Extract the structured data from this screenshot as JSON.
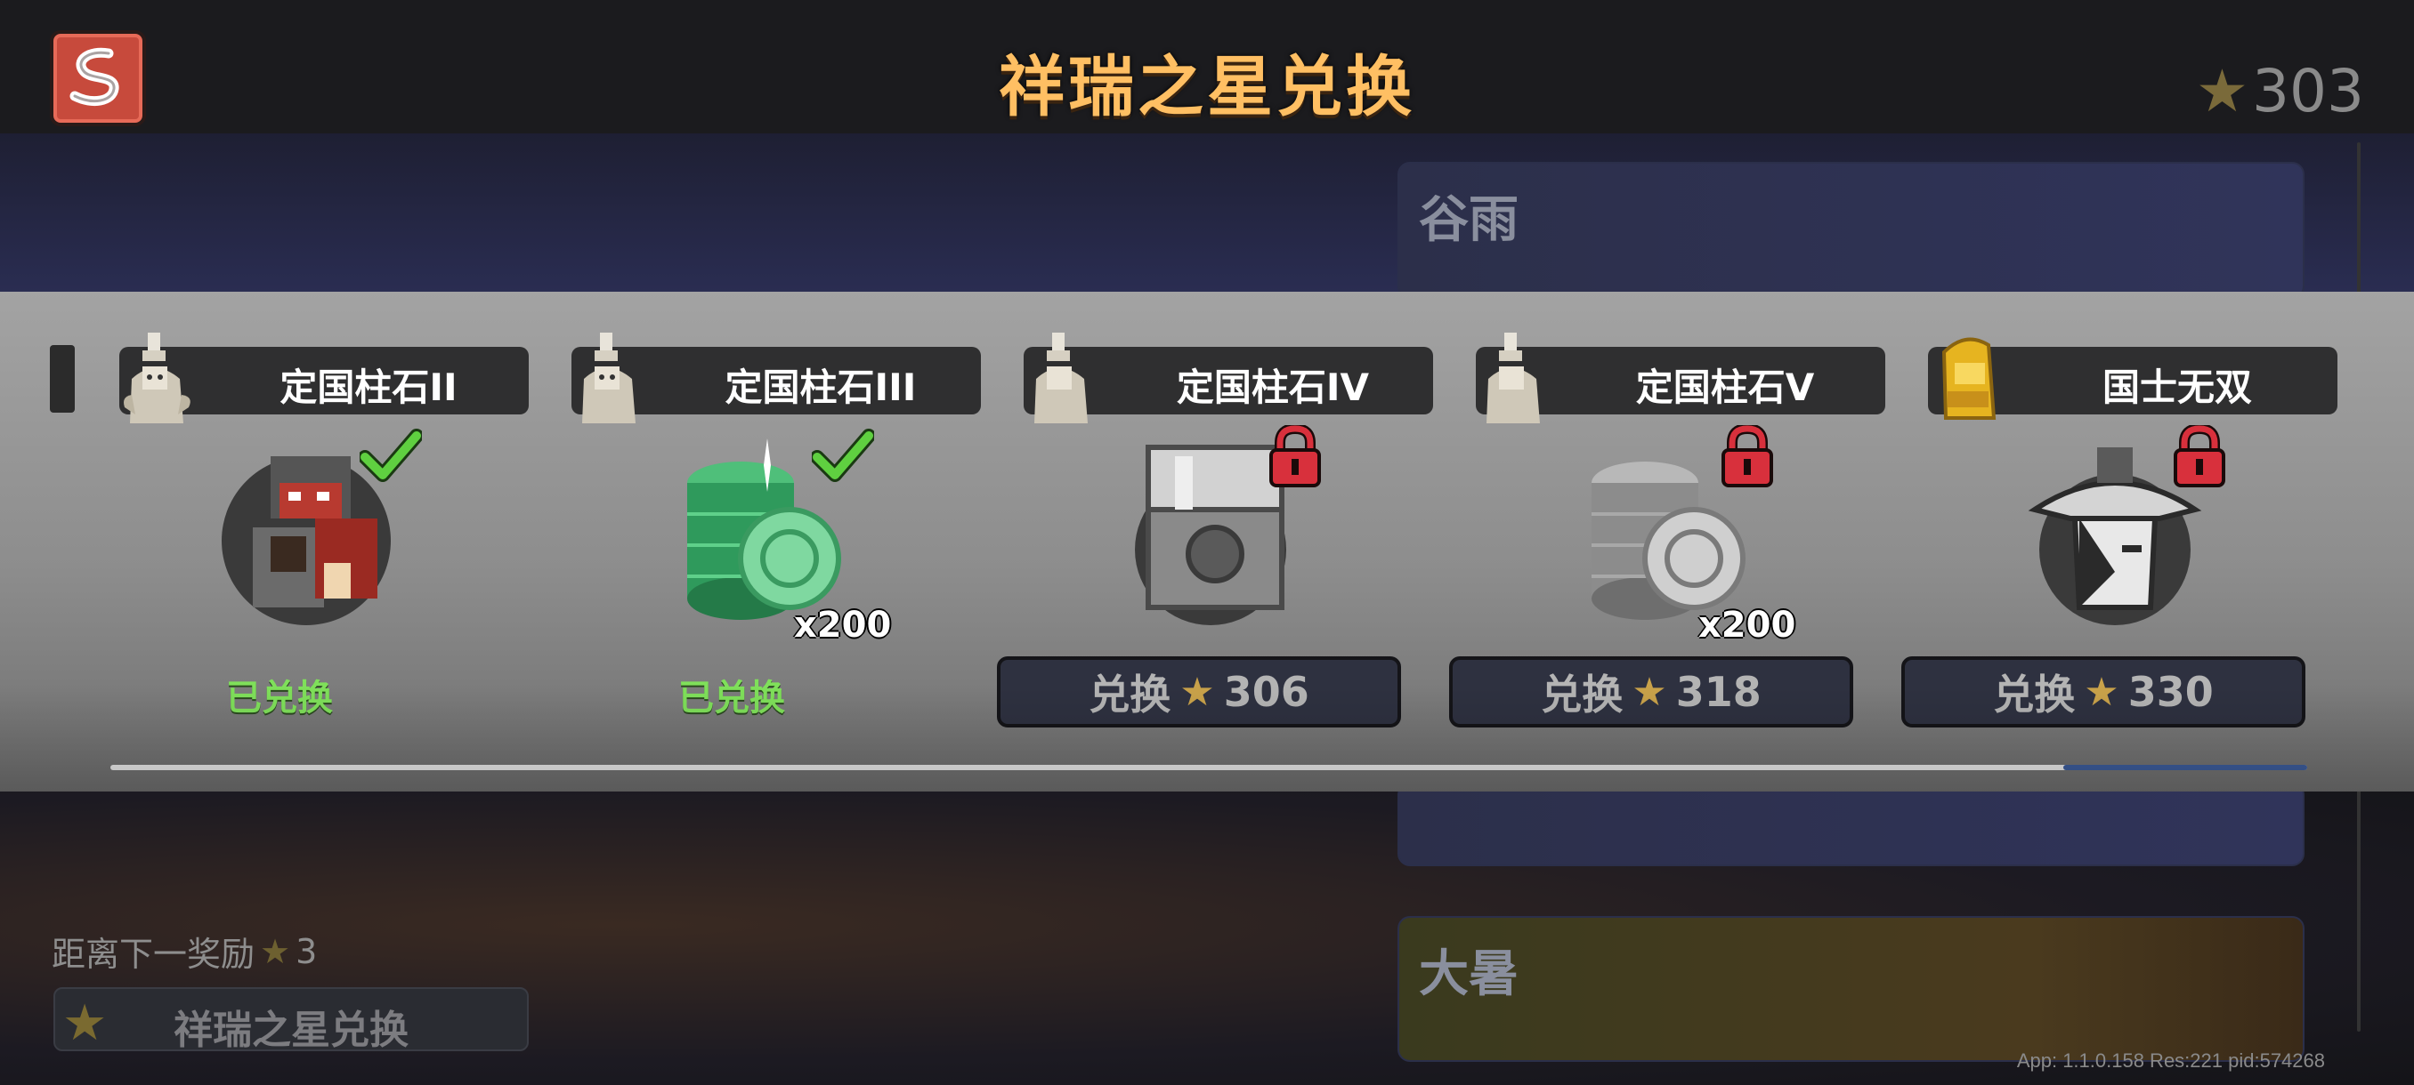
{
  "header": {
    "title": "祥瑞之星兑换",
    "star_total": "303"
  },
  "background_cards": [
    {
      "title": "谷雨"
    },
    {
      "title": "大暑"
    }
  ],
  "rewards": [
    {
      "name": "定国柱石II",
      "status": "redeemed",
      "status_label": "已兑换",
      "name_icon": "statue-icon",
      "item_icon": "warrior-portrait-icon"
    },
    {
      "name": "定国柱石III",
      "status": "redeemed",
      "status_label": "已兑换",
      "quantity": "x200",
      "name_icon": "statue-icon",
      "item_icon": "jade-coins-icon"
    },
    {
      "name": "定国柱石IV",
      "status": "locked",
      "redeem_label": "兑换",
      "cost": "306",
      "name_icon": "statue-icon",
      "item_icon": "treasure-chest-icon"
    },
    {
      "name": "定国柱石V",
      "status": "locked",
      "redeem_label": "兑换",
      "cost": "318",
      "quantity": "x200",
      "name_icon": "statue-icon",
      "item_icon": "coins-icon"
    },
    {
      "name": "国士无双",
      "status": "locked",
      "redeem_label": "兑换",
      "cost": "330",
      "name_icon": "gold-statue-icon",
      "item_icon": "hat-hero-portrait-icon"
    }
  ],
  "progress": {
    "fraction": 0.89
  },
  "next_reward": {
    "label": "距离下一奖励",
    "value": "3"
  },
  "bottom_button": {
    "label": "祥瑞之星兑换"
  },
  "footer": {
    "text": "App: 1.1.0.158 Res:221 pid:574268"
  },
  "colors": {
    "title": "#ffbf63",
    "redeemed": "#7fe05a",
    "lock": "#d8303c",
    "check": "#5fd040",
    "star": "#c9a24a"
  }
}
